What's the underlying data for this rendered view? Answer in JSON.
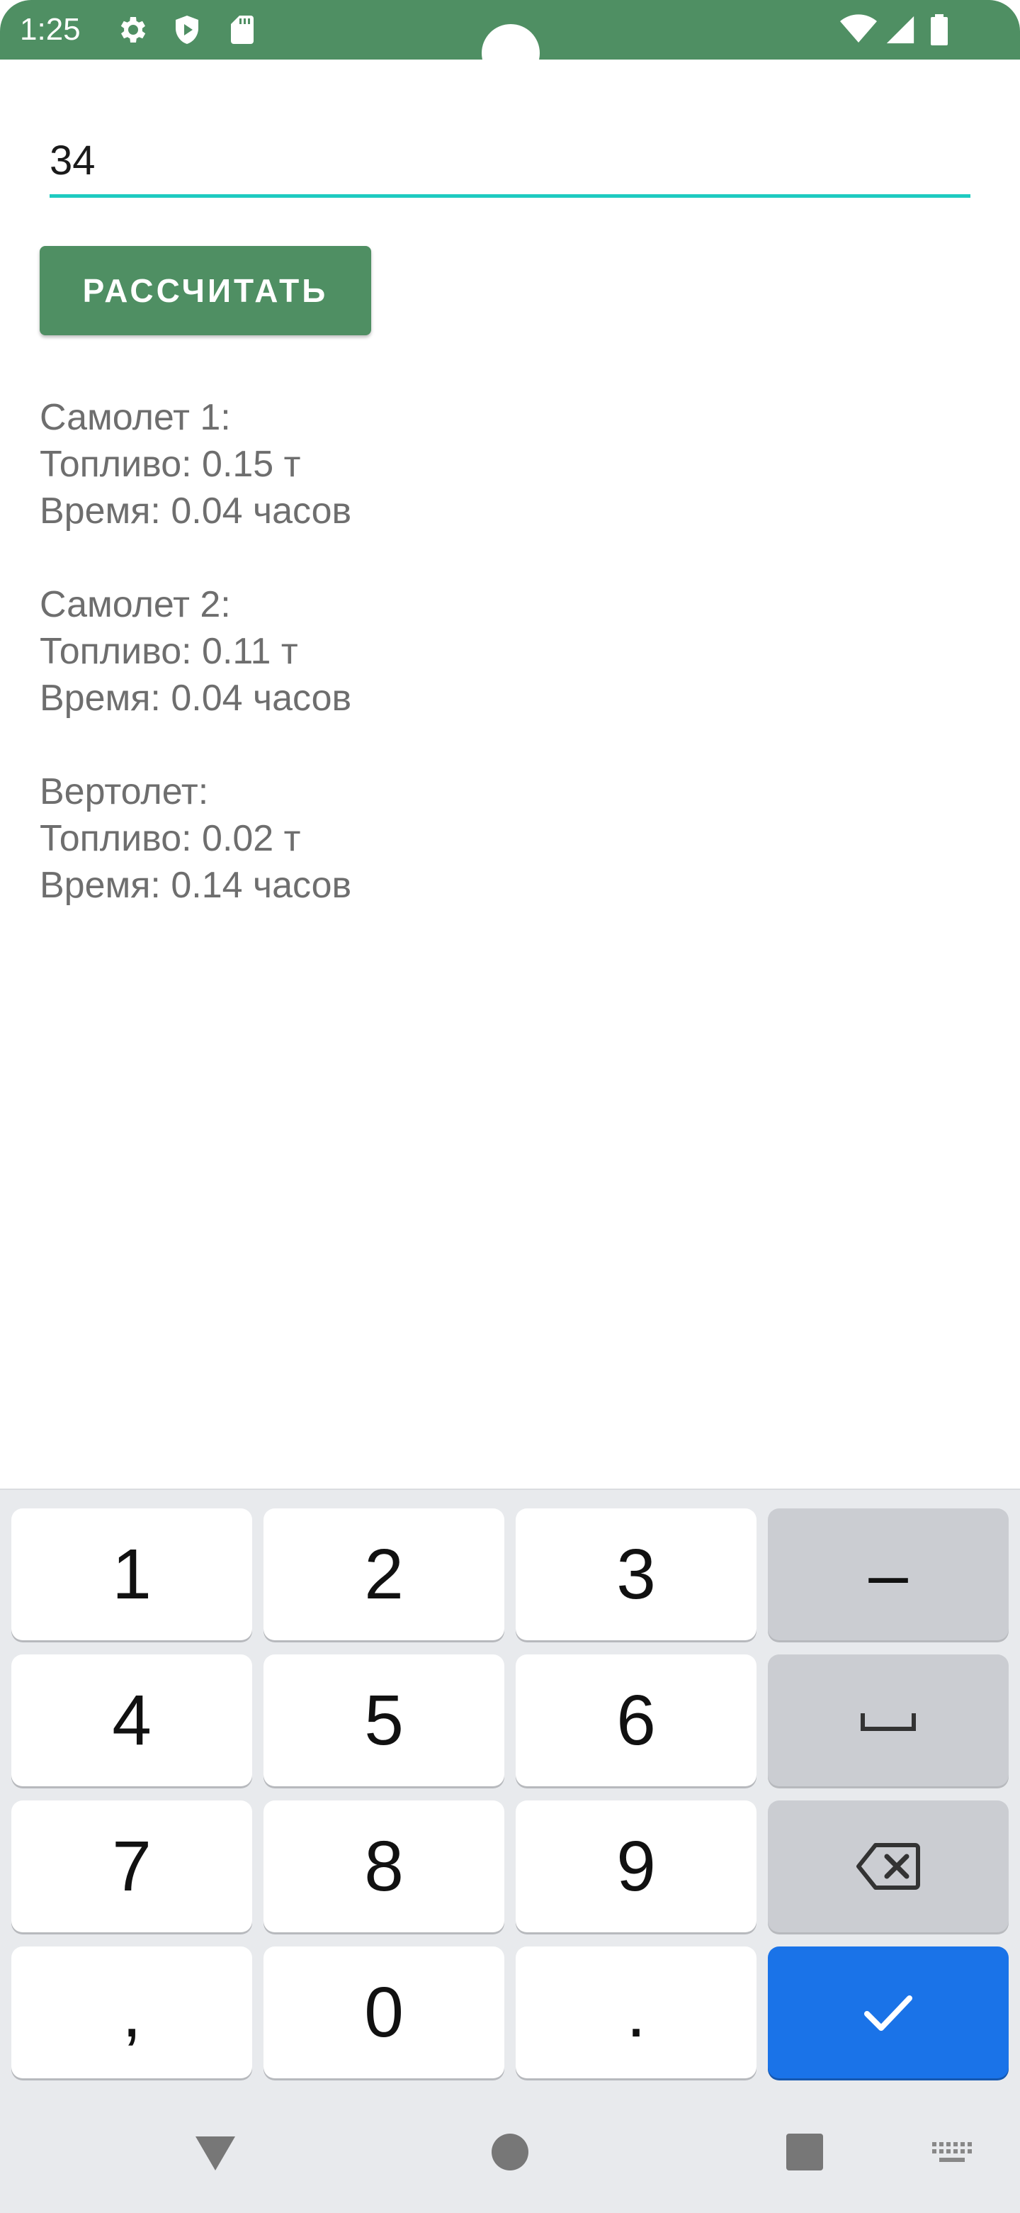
{
  "status_bar": {
    "time": "1:25",
    "icons": [
      "settings-icon",
      "shield-play-icon",
      "sd-card-icon",
      "wifi-icon",
      "signal-icon",
      "battery-icon"
    ],
    "color": "#4f8f63"
  },
  "input": {
    "value": "34",
    "accent_color": "#1ecbc1"
  },
  "calculate_button": {
    "label": "РАССЧИТАТЬ"
  },
  "results": [
    {
      "title": "Самолет 1:",
      "fuel": "Топливо: 0.15 т",
      "time": "Время: 0.04 часов"
    },
    {
      "title": "Самолет 2:",
      "fuel": "Топливо: 0.11 т",
      "time": "Время: 0.04 часов"
    },
    {
      "title": "Вертолет:",
      "fuel": "Топливо: 0.02 т",
      "time": "Время: 0.14 часов"
    }
  ],
  "keyboard": {
    "keys": {
      "k1": "1",
      "k2": "2",
      "k3": "3",
      "minus": "–",
      "k4": "4",
      "k5": "5",
      "k6": "6",
      "k7": "7",
      "k8": "8",
      "k9": "9",
      "comma": ",",
      "k0": "0",
      "period": "."
    },
    "enter_color": "#1a73e8",
    "icons": [
      "space-icon",
      "backspace-icon",
      "checkmark-icon"
    ]
  },
  "nav_bar": {
    "icons": [
      "back-icon",
      "home-icon",
      "recents-icon",
      "keyboard-switch-icon"
    ]
  }
}
